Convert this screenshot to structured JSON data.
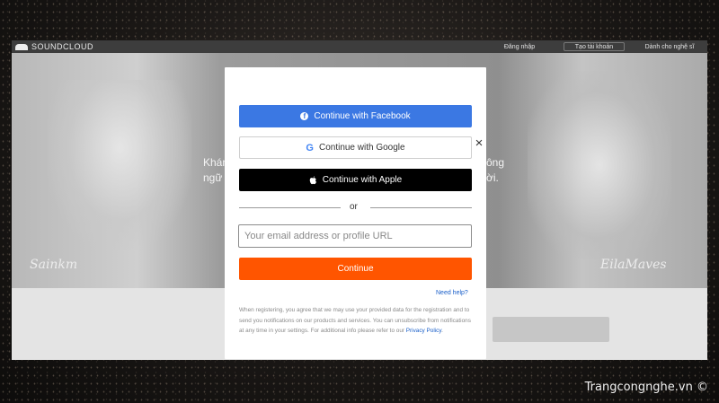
{
  "background": {
    "site": {
      "logo_text": "SOUNDCLOUD",
      "header_links": [
        "Đăng nhập",
        "Tạo tài khoản",
        "Dành cho nghệ sĩ"
      ],
      "hero_left_lines": [
        "Khám",
        "ngữ"
      ],
      "hero_right_lines": [
        "ông",
        "ời."
      ],
      "signature_left": "Sainkm",
      "signature_right": "EilaMaves"
    }
  },
  "watermark": "Trangcongnghe.vn ©",
  "modal": {
    "close_symbol": "×",
    "facebook": {
      "label": "Continue with Facebook",
      "icon": "facebook-icon",
      "color": "#3b78e3"
    },
    "google": {
      "label": "Continue with Google",
      "icon": "google-icon"
    },
    "apple": {
      "label": "Continue with Apple",
      "icon": "apple-icon"
    },
    "or_text": "or",
    "email": {
      "placeholder": "Your email address or profile URL",
      "value": ""
    },
    "continue": {
      "label": "Continue",
      "color": "#ff5500"
    },
    "help_link": "Need help?",
    "legal_text": "When registering, you agree that we may use your provided data for the registration and to send you notifications on our products and services. You can unsubscribe from notifications at any time in your settings. For additional info please refer to our ",
    "privacy_link": "Privacy Policy",
    "legal_end": "."
  }
}
